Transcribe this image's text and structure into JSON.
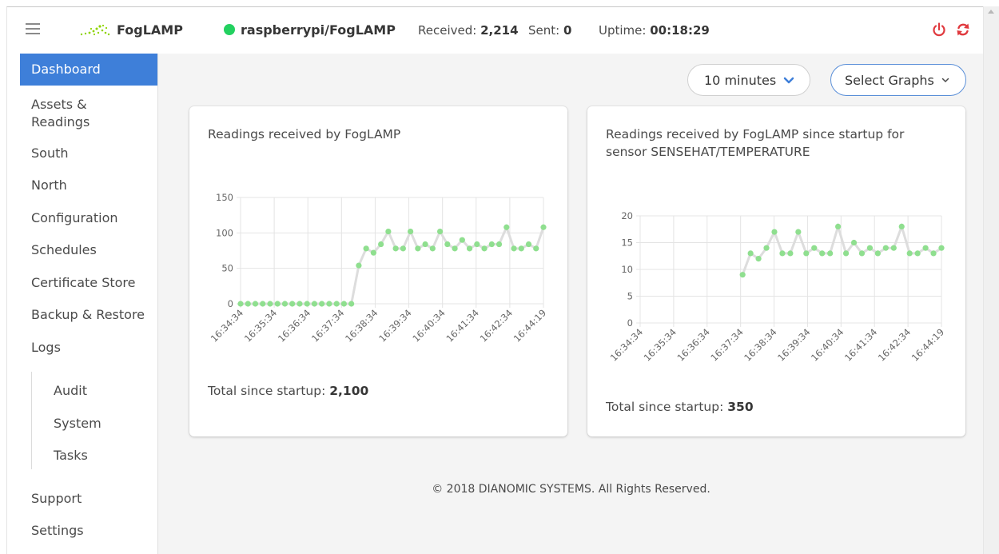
{
  "header": {
    "brand": "FogLAMP",
    "host": "raspberrypi/FogLAMP",
    "received_label": "Received:",
    "received_value": "2,214",
    "sent_label": "Sent:",
    "sent_value": "0",
    "uptime_label": "Uptime:",
    "uptime_value": "00:18:29",
    "status_color": "#23d160",
    "icons": [
      "menu-icon",
      "foglamp-logo-icon",
      "power-icon",
      "sync-icon"
    ]
  },
  "sidebar": {
    "items": [
      {
        "label": "Dashboard",
        "active": true
      },
      {
        "label": "Assets &\nReadings"
      },
      {
        "label": "South"
      },
      {
        "label": "North"
      },
      {
        "label": "Configuration"
      },
      {
        "label": "Schedules"
      },
      {
        "label": "Certificate Store"
      },
      {
        "label": "Backup & Restore"
      },
      {
        "label": "Logs"
      },
      {
        "label": "Support"
      },
      {
        "label": "Settings"
      }
    ],
    "logs_children": [
      {
        "label": "Audit"
      },
      {
        "label": "System"
      },
      {
        "label": "Tasks"
      }
    ]
  },
  "controls": {
    "time_range": "10 minutes",
    "select_graphs": "Select Graphs"
  },
  "cards": [
    {
      "title": "Readings received by FogLAMP",
      "total_label": "Total since startup:",
      "total_value": "2,100"
    },
    {
      "title": "Readings received by FogLAMP since startup for sensor SENSEHAT/TEMPERATURE",
      "total_label": "Total since startup:",
      "total_value": "350"
    }
  ],
  "chart_data": [
    {
      "type": "line",
      "title": "Readings received by FogLAMP",
      "x_tick_labels": [
        "16:34:34",
        "16:35:34",
        "16:36:34",
        "16:37:34",
        "16:38:34",
        "16:39:34",
        "16:40:34",
        "16:41:34",
        "16:42:34",
        "16:44:19"
      ],
      "ylim": [
        0,
        150
      ],
      "y_ticks": [
        0,
        50,
        100,
        150
      ],
      "grid": true,
      "line_color": "#dddddd",
      "point_color": "#8fdf8f",
      "series": [
        {
          "values": [
            0,
            0,
            0,
            0,
            0,
            0,
            0,
            0,
            0,
            0,
            0,
            0,
            0,
            0,
            0,
            0,
            54,
            78,
            72,
            84,
            102,
            78,
            78,
            102,
            78,
            84,
            78,
            102,
            84,
            78,
            90,
            78,
            84,
            78,
            84,
            84,
            108,
            78,
            78,
            84,
            78,
            108
          ]
        }
      ]
    },
    {
      "type": "line",
      "title": "Readings received by FogLAMP since startup for sensor SENSEHAT/TEMPERATURE",
      "x_tick_labels": [
        "16:34:34",
        "16:35:34",
        "16:36:34",
        "16:37:34",
        "16:38:34",
        "16:39:34",
        "16:40:34",
        "16:41:34",
        "16:42:34",
        "16:44:19"
      ],
      "ylim": [
        0,
        20
      ],
      "y_ticks": [
        0,
        5,
        10,
        15,
        20
      ],
      "grid": true,
      "line_color": "#dddddd",
      "point_color": "#8fdf8f",
      "series": [
        {
          "values": [
            9,
            13,
            12,
            14,
            17,
            13,
            13,
            17,
            13,
            14,
            13,
            13,
            18,
            13,
            15,
            13,
            14,
            13,
            14,
            14,
            18,
            13,
            13,
            14,
            13,
            14
          ]
        }
      ]
    }
  ],
  "footer": "© 2018 DIANOMIC SYSTEMS. All Rights Reserved."
}
